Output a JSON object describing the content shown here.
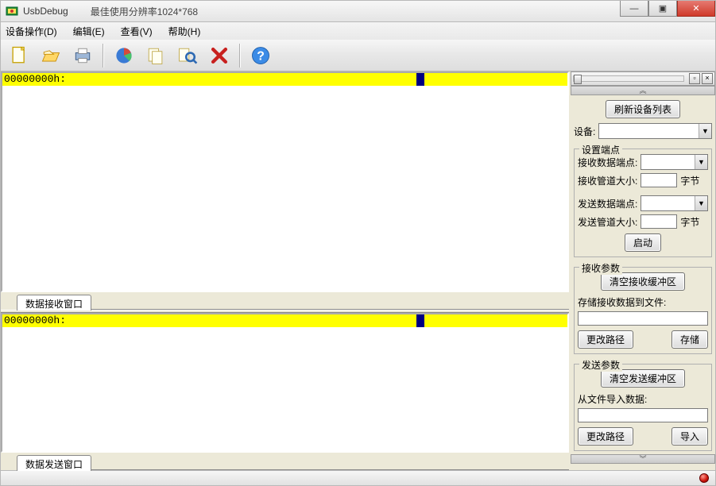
{
  "title": "UsbDebug",
  "subtitle": "最佳使用分辨率1024*768",
  "menus": {
    "device": "设备操作(D)",
    "edit": "编辑(E)",
    "view": "查看(V)",
    "help": "帮助(H)"
  },
  "hex": {
    "addr_rx": "00000000h:",
    "addr_tx": "00000000h:"
  },
  "tabs": {
    "rx": "数据接收窗口",
    "tx": "数据发送窗口"
  },
  "side": {
    "refresh": "刷新设备列表",
    "device_label": "设备:",
    "endpoint_group": "设置端点",
    "rx_ep_label": "接收数据端点:",
    "rx_pipe_label": "接收管道大小:",
    "tx_ep_label": "发送数据端点:",
    "tx_pipe_label": "发送管道大小:",
    "bytes_suffix": "字节",
    "start_btn": "启动",
    "rx_param_group": "接收参数",
    "clear_rx_btn": "清空接收缓冲区",
    "save_rx_label": "存储接收数据到文件:",
    "change_path_btn": "更改路径",
    "save_btn": "存储",
    "tx_param_group": "发送参数",
    "clear_tx_btn": "清空发送缓冲区",
    "import_label": "从文件导入数据:",
    "change_path_btn2": "更改路径",
    "import_btn": "导入",
    "rx_pipe_value": "",
    "tx_pipe_value": "",
    "save_path_value": "",
    "import_path_value": ""
  },
  "winbtns": {
    "min": "—",
    "max": "▣",
    "close": "✕"
  },
  "collapser_up": "︽",
  "collapser_down": "︾"
}
